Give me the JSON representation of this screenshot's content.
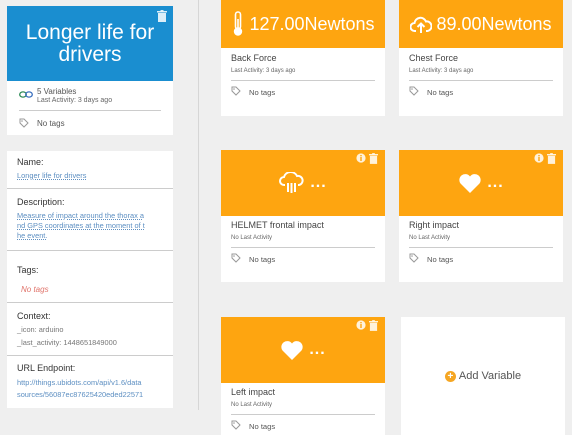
{
  "datasource": {
    "title": "Longer life for drivers",
    "variables_count": "5 Variables",
    "last_activity": "Last Activity: 3 days ago",
    "tags": "No tags"
  },
  "details": {
    "name_label": "Name:",
    "name_value": "Longer life for drivers",
    "description_label": "Description:",
    "description_line1": "Measure of impact around the thorax a",
    "description_line2": "nd GPS coordinates at the moment of t",
    "description_line3": "he event.",
    "tags_label": "Tags:",
    "tags_value": "No tags",
    "context_label": "Context:",
    "context_icon": "_icon: arduino",
    "context_last_activity": "_last_activity: 1448651849000",
    "url_label": "URL Endpoint:",
    "url_line1": "http://things.ubidots.com/api/v1.6/data",
    "url_line2": "sources/56087ec87625420eded22571"
  },
  "variables": [
    {
      "name": "Back Force",
      "value": "127.00Newtons",
      "icon": "thermometer-icon",
      "last_activity": "Last Activity: 3 days ago",
      "tags": "No tags"
    },
    {
      "name": "Chest Force",
      "value": "89.00Newtons",
      "icon": "cloud-upload-icon",
      "last_activity": "Last Activity: 3 days ago",
      "tags": "No tags"
    },
    {
      "name": "HELMET frontal impact",
      "value": "...",
      "icon": "cloud-rain-icon",
      "last_activity": "No Last Activity",
      "tags": "No tags"
    },
    {
      "name": "Right impact",
      "value": "...",
      "icon": "heart-icon",
      "last_activity": "No Last Activity",
      "tags": "No tags"
    },
    {
      "name": "Left impact",
      "value": "...",
      "icon": "heart-icon",
      "last_activity": "No Last Activity",
      "tags": "No tags"
    }
  ],
  "add_variable": {
    "label": "Add Variable"
  },
  "colors": {
    "datasource_blue": "#1a8ed0",
    "variable_orange": "#fea510",
    "link_blue": "#5d8fc2",
    "no_tags_red": "#e0736a"
  }
}
